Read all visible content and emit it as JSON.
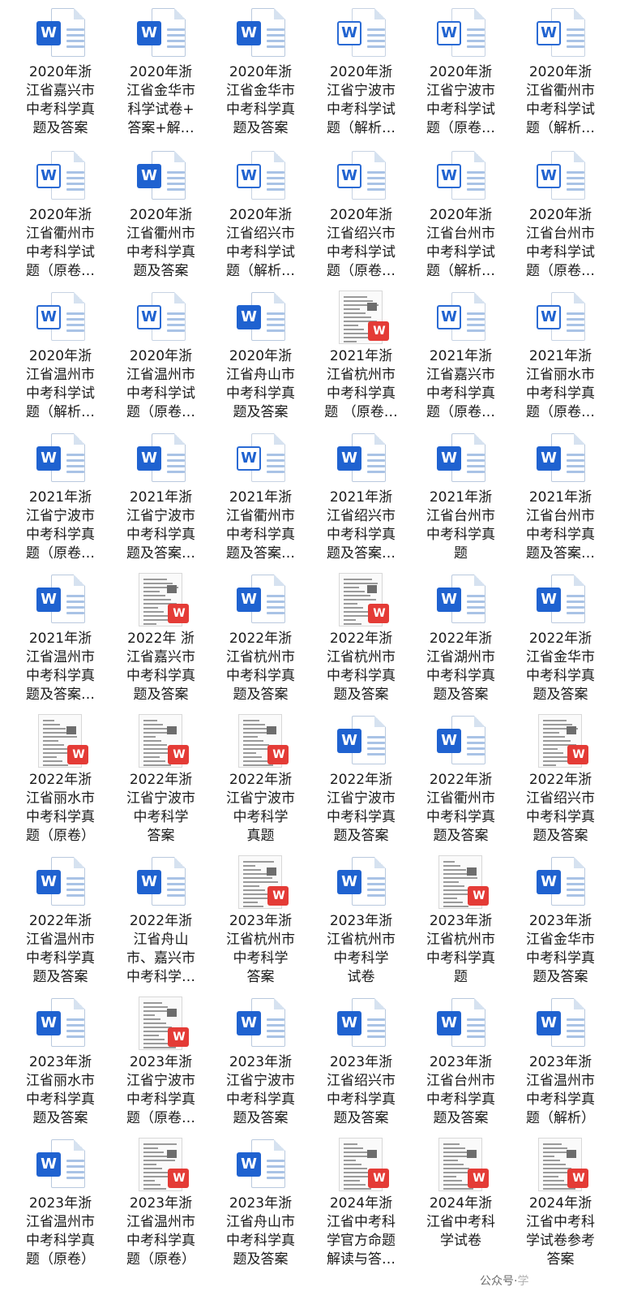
{
  "watermark": {
    "text": "公众号·",
    "suffix": "学"
  },
  "files": [
    {
      "type": "word",
      "style": "solid",
      "lines": [
        "2020年浙",
        "江省嘉兴市",
        "中考科学真",
        "题及答案"
      ]
    },
    {
      "type": "word",
      "style": "solid",
      "lines": [
        "2020年浙",
        "江省金华市",
        "科学试卷+",
        "答案+解…"
      ]
    },
    {
      "type": "word",
      "style": "solid",
      "lines": [
        "2020年浙",
        "江省金华市",
        "中考科学真",
        "题及答案"
      ]
    },
    {
      "type": "word",
      "style": "light",
      "lines": [
        "2020年浙",
        "江省宁波市",
        "中考科学试",
        "题（解析…"
      ]
    },
    {
      "type": "word",
      "style": "light",
      "lines": [
        "2020年浙",
        "江省宁波市",
        "中考科学试",
        "题（原卷…"
      ]
    },
    {
      "type": "word",
      "style": "light",
      "lines": [
        "2020年浙",
        "江省衢州市",
        "中考科学试",
        "题（解析…"
      ]
    },
    {
      "type": "word",
      "style": "light",
      "lines": [
        "2020年浙",
        "江省衢州市",
        "中考科学试",
        "题（原卷…"
      ]
    },
    {
      "type": "word",
      "style": "solid",
      "lines": [
        "2020年浙",
        "江省衢州市",
        "中考科学真",
        "题及答案"
      ]
    },
    {
      "type": "word",
      "style": "light",
      "lines": [
        "2020年浙",
        "江省绍兴市",
        "中考科学试",
        "题（解析…"
      ]
    },
    {
      "type": "word",
      "style": "light",
      "lines": [
        "2020年浙",
        "江省绍兴市",
        "中考科学试",
        "题（原卷…"
      ]
    },
    {
      "type": "word",
      "style": "light",
      "lines": [
        "2020年浙",
        "江省台州市",
        "中考科学试",
        "题（解析…"
      ]
    },
    {
      "type": "word",
      "style": "light",
      "lines": [
        "2020年浙",
        "江省台州市",
        "中考科学试",
        "题（原卷…"
      ]
    },
    {
      "type": "word",
      "style": "light",
      "lines": [
        "2020年浙",
        "江省温州市",
        "中考科学试",
        "题（解析…"
      ]
    },
    {
      "type": "word",
      "style": "light",
      "lines": [
        "2020年浙",
        "江省温州市",
        "中考科学试",
        "题（原卷…"
      ]
    },
    {
      "type": "word",
      "style": "solid",
      "lines": [
        "2020年浙",
        "江省舟山市",
        "中考科学真",
        "题及答案"
      ]
    },
    {
      "type": "pdf",
      "lines": [
        "2021年浙",
        "江省杭州市",
        "中考科学真",
        "题 （原卷…"
      ]
    },
    {
      "type": "word",
      "style": "light",
      "lines": [
        "2021年浙",
        "江省嘉兴市",
        "中考科学真",
        "题（原卷…"
      ]
    },
    {
      "type": "word",
      "style": "light",
      "lines": [
        "2021年浙",
        "江省丽水市",
        "中考科学真",
        "题（原卷…"
      ]
    },
    {
      "type": "word",
      "style": "solid",
      "lines": [
        "2021年浙",
        "江省宁波市",
        "中考科学真",
        "题（原卷…"
      ]
    },
    {
      "type": "word",
      "style": "solid",
      "lines": [
        "2021年浙",
        "江省宁波市",
        "中考科学真",
        "题及答案…"
      ]
    },
    {
      "type": "word",
      "style": "light",
      "lines": [
        "2021年浙",
        "江省衢州市",
        "中考科学真",
        "题及答案…"
      ]
    },
    {
      "type": "word",
      "style": "solid",
      "lines": [
        "2021年浙",
        "江省绍兴市",
        "中考科学真",
        "题及答案…"
      ]
    },
    {
      "type": "word",
      "style": "solid",
      "lines": [
        "2021年浙",
        "江省台州市",
        "中考科学真",
        "题"
      ]
    },
    {
      "type": "word",
      "style": "solid",
      "lines": [
        "2021年浙",
        "江省台州市",
        "中考科学真",
        "题及答案…"
      ]
    },
    {
      "type": "word",
      "style": "solid",
      "lines": [
        "2021年浙",
        "江省温州市",
        "中考科学真",
        "题及答案…"
      ]
    },
    {
      "type": "pdf",
      "lines": [
        "2022年 浙",
        "江省嘉兴市",
        "中考科学真",
        "题及答案"
      ]
    },
    {
      "type": "word",
      "style": "solid",
      "lines": [
        "2022年浙",
        "江省杭州市",
        "中考科学真",
        "题及答案"
      ]
    },
    {
      "type": "pdf",
      "lines": [
        "2022年浙",
        "江省杭州市",
        "中考科学真",
        "题及答案"
      ]
    },
    {
      "type": "word",
      "style": "solid",
      "lines": [
        "2022年浙",
        "江省湖州市",
        "中考科学真",
        "题及答案"
      ]
    },
    {
      "type": "word",
      "style": "solid",
      "lines": [
        "2022年浙",
        "江省金华市",
        "中考科学真",
        "题及答案"
      ]
    },
    {
      "type": "pdf",
      "lines": [
        "2022年浙",
        "江省丽水市",
        "中考科学真",
        "题（原卷）"
      ]
    },
    {
      "type": "pdf",
      "lines": [
        "2022年浙",
        "江省宁波市",
        "中考科学",
        "答案"
      ]
    },
    {
      "type": "pdf",
      "lines": [
        "2022年浙",
        "江省宁波市",
        "中考科学",
        "真题"
      ]
    },
    {
      "type": "word",
      "style": "solid",
      "lines": [
        "2022年浙",
        "江省宁波市",
        "中考科学真",
        "题及答案"
      ]
    },
    {
      "type": "word",
      "style": "solid",
      "lines": [
        "2022年浙",
        "江省衢州市",
        "中考科学真",
        "题及答案"
      ]
    },
    {
      "type": "pdf",
      "lines": [
        "2022年浙",
        "江省绍兴市",
        "中考科学真",
        "题及答案"
      ]
    },
    {
      "type": "word",
      "style": "solid",
      "lines": [
        "2022年浙",
        "江省温州市",
        "中考科学真",
        "题及答案"
      ]
    },
    {
      "type": "word",
      "style": "solid",
      "lines": [
        "2022年浙",
        "江省舟山",
        "市、嘉兴市",
        "中考科学…"
      ]
    },
    {
      "type": "pdf",
      "lines": [
        "2023年浙",
        "江省杭州市",
        "中考科学",
        "答案"
      ]
    },
    {
      "type": "word",
      "style": "solid",
      "lines": [
        "2023年浙",
        "江省杭州市",
        "中考科学",
        "试卷"
      ]
    },
    {
      "type": "pdf",
      "lines": [
        "2023年浙",
        "江省杭州市",
        "中考科学真",
        "题"
      ]
    },
    {
      "type": "word",
      "style": "solid",
      "lines": [
        "2023年浙",
        "江省金华市",
        "中考科学真",
        "题及答案"
      ]
    },
    {
      "type": "word",
      "style": "solid",
      "lines": [
        "2023年浙",
        "江省丽水市",
        "中考科学真",
        "题及答案"
      ]
    },
    {
      "type": "pdf",
      "lines": [
        "2023年浙",
        "江省宁波市",
        "中考科学真",
        "题（原卷…"
      ]
    },
    {
      "type": "word",
      "style": "solid",
      "lines": [
        "2023年浙",
        "江省宁波市",
        "中考科学真",
        "题及答案"
      ]
    },
    {
      "type": "word",
      "style": "solid",
      "lines": [
        "2023年浙",
        "江省绍兴市",
        "中考科学真",
        "题及答案"
      ]
    },
    {
      "type": "word",
      "style": "solid",
      "lines": [
        "2023年浙",
        "江省台州市",
        "中考科学真",
        "题及答案"
      ]
    },
    {
      "type": "word",
      "style": "solid",
      "lines": [
        "2023年浙",
        "江省温州市",
        "中考科学真",
        "题（解析）"
      ]
    },
    {
      "type": "word",
      "style": "solid",
      "lines": [
        "2023年浙",
        "江省温州市",
        "中考科学真",
        "题（原卷）"
      ]
    },
    {
      "type": "pdf",
      "lines": [
        "2023年浙",
        "江省温州市",
        "中考科学真",
        "题（原卷）"
      ]
    },
    {
      "type": "word",
      "style": "solid",
      "lines": [
        "2023年浙",
        "江省舟山市",
        "中考科学真",
        "题及答案"
      ]
    },
    {
      "type": "pdf",
      "lines": [
        "2024年浙",
        "江省中考科",
        "学官方命题",
        "解读与答…"
      ]
    },
    {
      "type": "pdf",
      "lines": [
        "2024年浙",
        "江省中考科",
        "学试卷",
        ""
      ]
    },
    {
      "type": "pdf",
      "lines": [
        "2024年浙",
        "江省中考科",
        "学试卷参考",
        "答案"
      ]
    }
  ],
  "labels": {
    "word_badge": "W",
    "wps_badge": "W"
  }
}
